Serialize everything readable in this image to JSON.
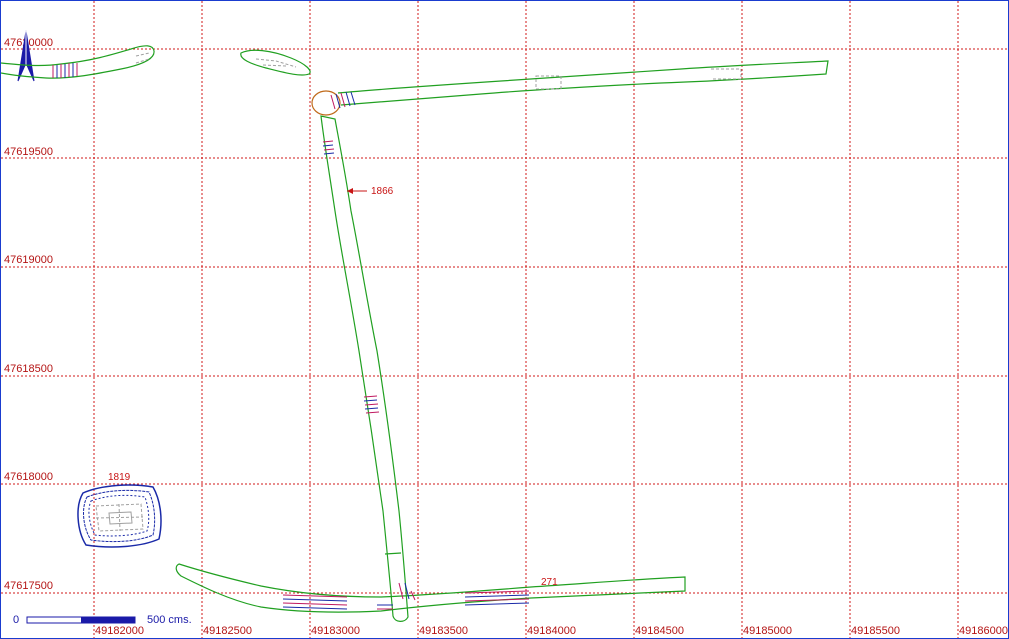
{
  "map": {
    "north_label": "",
    "y_labels": [
      "47620000",
      "47619500",
      "47619000",
      "47618500",
      "47618000",
      "47617500"
    ],
    "x_labels": [
      "49182000",
      "49182500",
      "49183000",
      "49183500",
      "49184000",
      "49184500",
      "49185000",
      "49185500",
      "49186000"
    ],
    "annotations": {
      "road_1866": "1866",
      "road_271": "271",
      "parcel_1819": "1819"
    },
    "scale_bar": {
      "start_label": "0",
      "end_label": "500 cms."
    },
    "colors": {
      "grid": "#d01818",
      "roads": "#21a021",
      "labels": "#b41414",
      "parcel": "#1a2aa8",
      "frame": "#1a3ccf"
    },
    "icons": [
      "north-arrow-icon"
    ]
  }
}
